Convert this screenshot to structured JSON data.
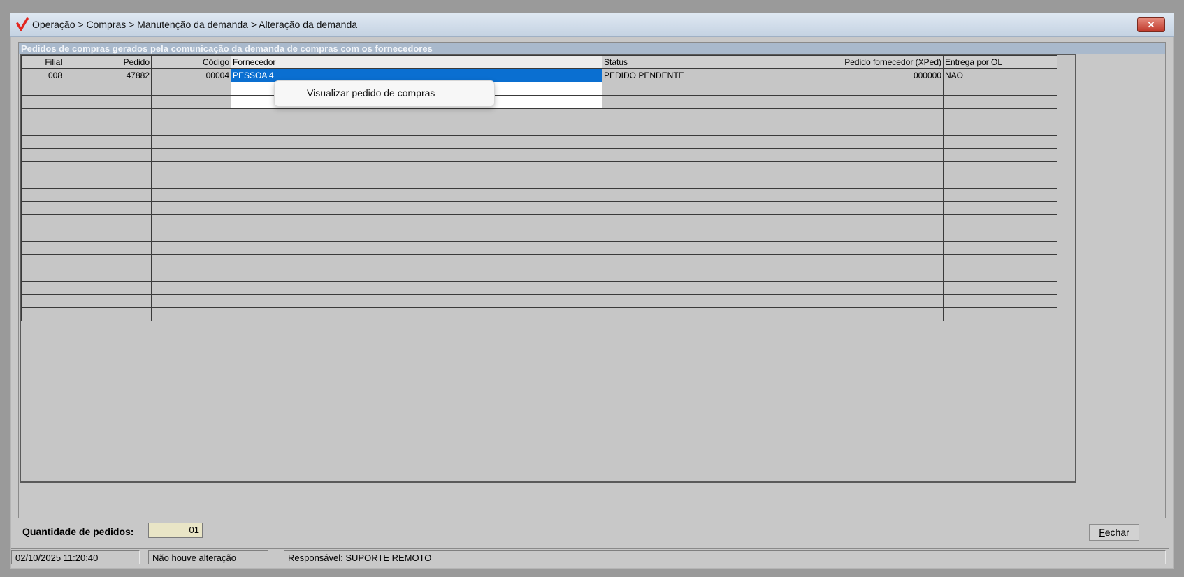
{
  "window": {
    "title": "Operação > Compras > Manutenção da demanda > Alteração da demanda",
    "close_symbol": "✕"
  },
  "group": {
    "title": "Pedidos de compras gerados pela comunicação da demanda de compras com os fornecedores"
  },
  "table": {
    "columns": [
      "Filial",
      "Pedido",
      "Código",
      "Fornecedor",
      "Status",
      "Pedido fornecedor (XPed)",
      "Entrega por OL"
    ],
    "rows": [
      [
        "008",
        "47882",
        "00004",
        "PESSOA 4",
        "PEDIDO PENDENTE",
        "000000",
        "NAO"
      ]
    ]
  },
  "context_menu": {
    "items": [
      "Visualizar pedido de compras"
    ]
  },
  "footer": {
    "quantity_label": "Quantidade de pedidos:",
    "quantity_value": "01",
    "close_button_first": "F",
    "close_button_rest": "echar"
  },
  "status": {
    "datetime": "02/10/2025 11:20:40",
    "change": "Não houve alteração",
    "responsible": "Responsável: SUPORTE REMOTO"
  },
  "colors": {
    "selection": "#0a6fd1",
    "group_header": "#a9b9cc",
    "quantity_field": "#e9e5c6"
  },
  "icons": {
    "app": "checkmark-logo-icon",
    "close": "close-icon"
  }
}
